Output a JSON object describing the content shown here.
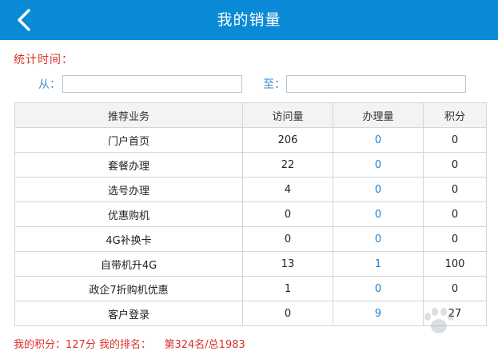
{
  "header": {
    "title": "我的销量"
  },
  "filter": {
    "stat_time_label": "统计时间：",
    "from_label": "从：",
    "from_value": "",
    "to_label": "至：",
    "to_value": ""
  },
  "table": {
    "columns": [
      "推荐业务",
      "访问量",
      "办理量",
      "积分"
    ],
    "rows": [
      {
        "business": "门户首页",
        "visits": "206",
        "handled": "0",
        "points": "0"
      },
      {
        "business": "套餐办理",
        "visits": "22",
        "handled": "0",
        "points": "0"
      },
      {
        "business": "选号办理",
        "visits": "4",
        "handled": "0",
        "points": "0"
      },
      {
        "business": "优惠购机",
        "visits": "0",
        "handled": "0",
        "points": "0"
      },
      {
        "business": "4G补换卡",
        "visits": "0",
        "handled": "0",
        "points": "0"
      },
      {
        "business": "自带机升4G",
        "visits": "13",
        "handled": "1",
        "points": "100"
      },
      {
        "business": "政企7折购机优惠",
        "visits": "1",
        "handled": "0",
        "points": "0"
      },
      {
        "business": "客户登录",
        "visits": "0",
        "handled": "9",
        "points": "27"
      }
    ]
  },
  "footer": {
    "text": "我的积分：127分 我的排名：    第324名/总1983"
  },
  "icons": {
    "back": "chevron-left-icon"
  },
  "colors": {
    "header_bg": "#0a89d6",
    "accent_red": "#d9302a",
    "link_blue": "#1f7dc9"
  }
}
